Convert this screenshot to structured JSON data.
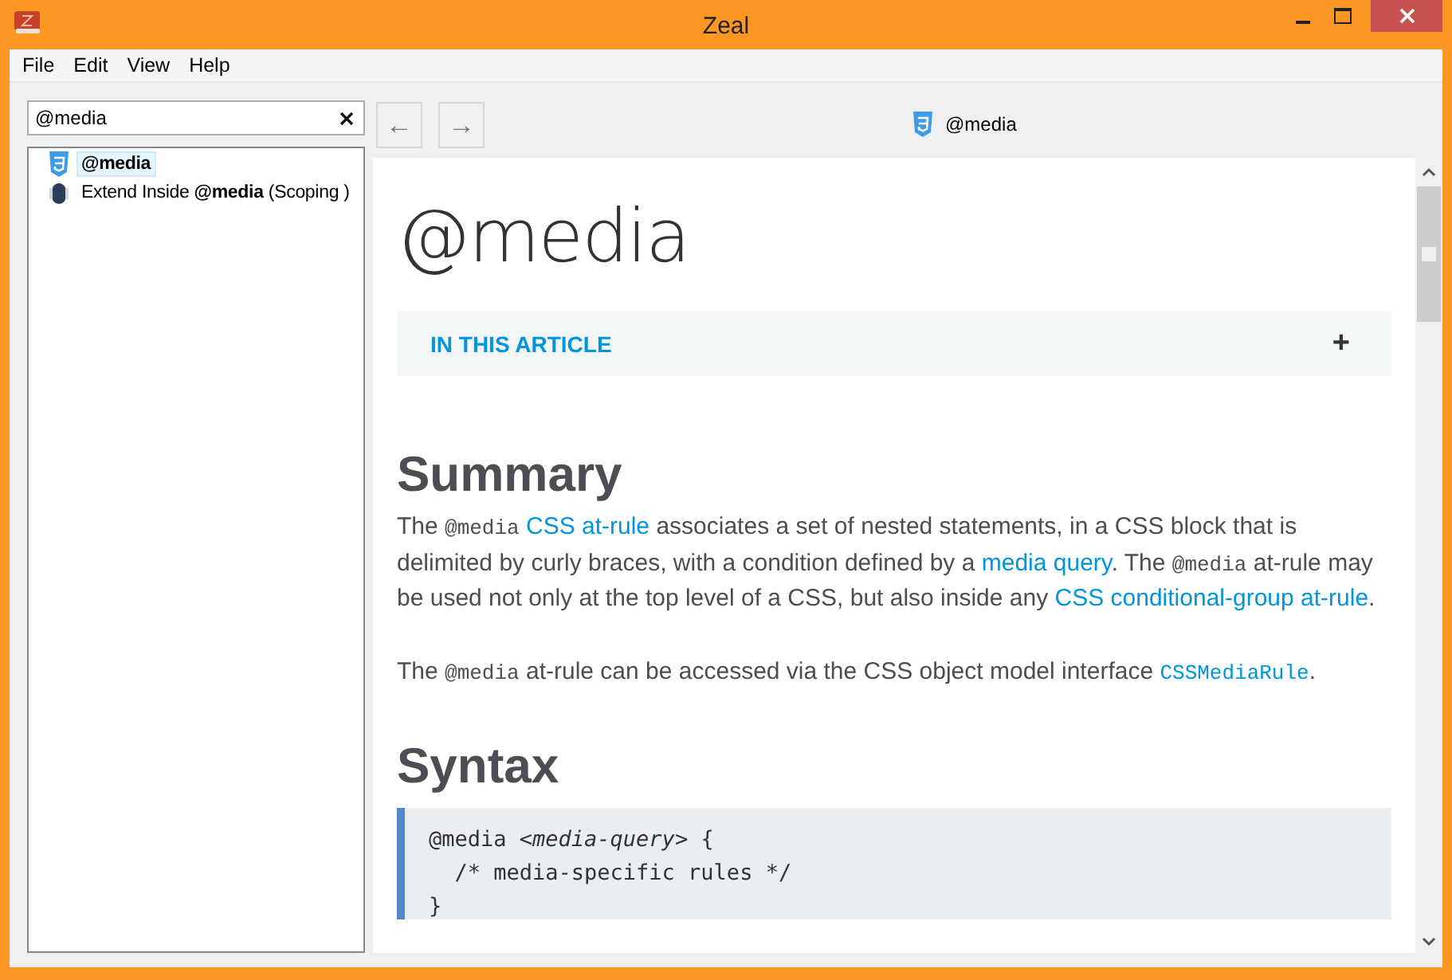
{
  "window": {
    "title": "Zeal"
  },
  "menu": [
    "File",
    "Edit",
    "View",
    "Help"
  ],
  "search": {
    "value": "@media"
  },
  "results": [
    {
      "kind": "css",
      "text": "**@media**",
      "selected": true
    },
    {
      "kind": "sass",
      "text": "Extend Inside **@media** (Scoping )",
      "selected": false
    }
  ],
  "nav": {
    "back": "←",
    "forward": "→"
  },
  "breadcrumb": {
    "kind": "css",
    "text": "@media"
  },
  "article": {
    "title": "@media",
    "toc": {
      "label": "IN THIS ARTICLE",
      "toggle": "+"
    },
    "sections": [
      {
        "heading": "Summary",
        "paragraphs": [
          [
            {
              "kind": "text",
              "text": "The "
            },
            {
              "kind": "code",
              "text": "@media",
              "space_after": true
            },
            {
              "kind": "link",
              "text": "CSS at-rule"
            },
            {
              "kind": "text",
              "text": " associates a set of nested statements, in a CSS block that is delimited by curly braces, with a condition defined by a "
            },
            {
              "kind": "link",
              "text": "media query"
            },
            {
              "kind": "text",
              "text": ". The "
            },
            {
              "kind": "code",
              "text": "@media"
            },
            {
              "kind": "text",
              "text": " at-rule may be used not only at the top level of a CSS, but also inside any "
            },
            {
              "kind": "link",
              "text": "CSS conditional-group at-rule"
            },
            {
              "kind": "text",
              "text": "."
            }
          ],
          [
            {
              "kind": "text",
              "text": "The "
            },
            {
              "kind": "code",
              "text": "@media"
            },
            {
              "kind": "text",
              "text": " at-rule can be accessed via the CSS object model interface "
            },
            {
              "kind": "codelink",
              "text": "CSSMediaRule"
            },
            {
              "kind": "text",
              "text": "."
            }
          ]
        ]
      },
      {
        "heading": "Syntax",
        "code": [
          "@media *<media-query>* {",
          "  /* media-specific rules */",
          "}"
        ]
      }
    ]
  }
}
